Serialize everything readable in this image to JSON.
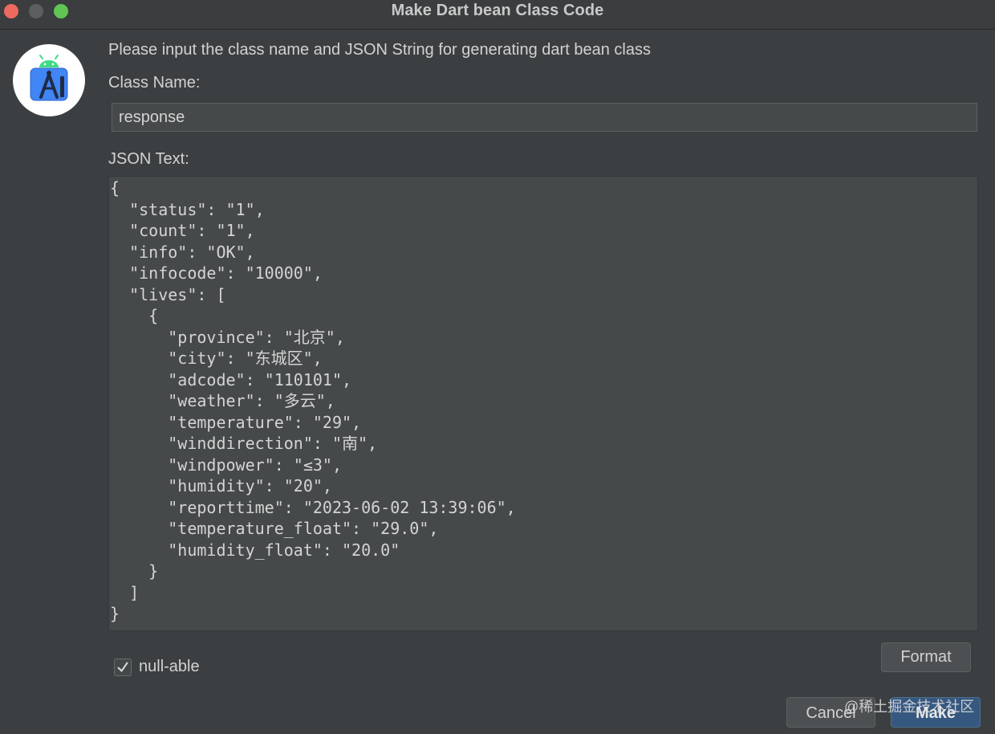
{
  "window": {
    "title": "Make Dart bean Class Code",
    "close_color": "#ec6a5e",
    "minimize_color": "#5c5f62",
    "maximize_color": "#61c554"
  },
  "app_icon": "android-studio-icon",
  "dialog": {
    "prompt": "Please input the class name and JSON String for generating dart bean class",
    "class_name_label": "Class Name:",
    "class_name_value": "response",
    "json_label": "JSON Text:",
    "json_text": "{\n  \"status\": \"1\",\n  \"count\": \"1\",\n  \"info\": \"OK\",\n  \"infocode\": \"10000\",\n  \"lives\": [\n    {\n      \"province\": \"北京\",\n      \"city\": \"东城区\",\n      \"adcode\": \"110101\",\n      \"weather\": \"多云\",\n      \"temperature\": \"29\",\n      \"winddirection\": \"南\",\n      \"windpower\": \"≤3\",\n      \"humidity\": \"20\",\n      \"reporttime\": \"2023-06-02 13:39:06\",\n      \"temperature_float\": \"29.0\",\n      \"humidity_float\": \"20.0\"\n    }\n  ]\n}",
    "format_label": "Format",
    "nullable_label": "null-able",
    "nullable_checked": true,
    "cancel_label": "Cancel",
    "make_label": "Make"
  },
  "watermark": "@稀土掘金技术社区",
  "colors": {
    "background": "#3c3f41",
    "field": "#45494a",
    "default_button": "#365880"
  }
}
